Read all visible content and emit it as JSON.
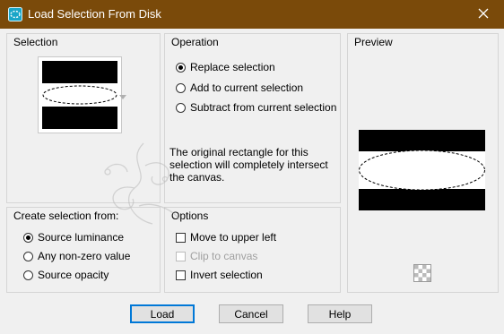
{
  "window": {
    "title": "Load Selection From Disk",
    "titlebar_color": "#7a4a0a",
    "accent_color": "#0078d7"
  },
  "selection_group": {
    "title": "Selection"
  },
  "operation_group": {
    "title": "Operation",
    "options": [
      {
        "label": "Replace selection",
        "checked": true
      },
      {
        "label": "Add to current selection",
        "checked": false
      },
      {
        "label": "Subtract from current selection",
        "checked": false
      }
    ],
    "info": "The original rectangle for this selection will completely intersect the canvas."
  },
  "preview_group": {
    "title": "Preview"
  },
  "create_group": {
    "title": "Create selection from:",
    "options": [
      {
        "label": "Source luminance",
        "checked": true
      },
      {
        "label": "Any non-zero value",
        "checked": false
      },
      {
        "label": "Source opacity",
        "checked": false
      }
    ]
  },
  "options_group": {
    "title": "Options",
    "items": [
      {
        "label": "Move to upper left",
        "checked": false,
        "disabled": false
      },
      {
        "label": "Clip to canvas",
        "checked": false,
        "disabled": true
      },
      {
        "label": "Invert selection",
        "checked": false,
        "disabled": false
      }
    ]
  },
  "buttons": {
    "load": "Load",
    "cancel": "Cancel",
    "help": "Help"
  },
  "icons": {
    "app": "selection-app-icon",
    "close": "close-icon",
    "transparency": "transparency-checker-icon"
  }
}
